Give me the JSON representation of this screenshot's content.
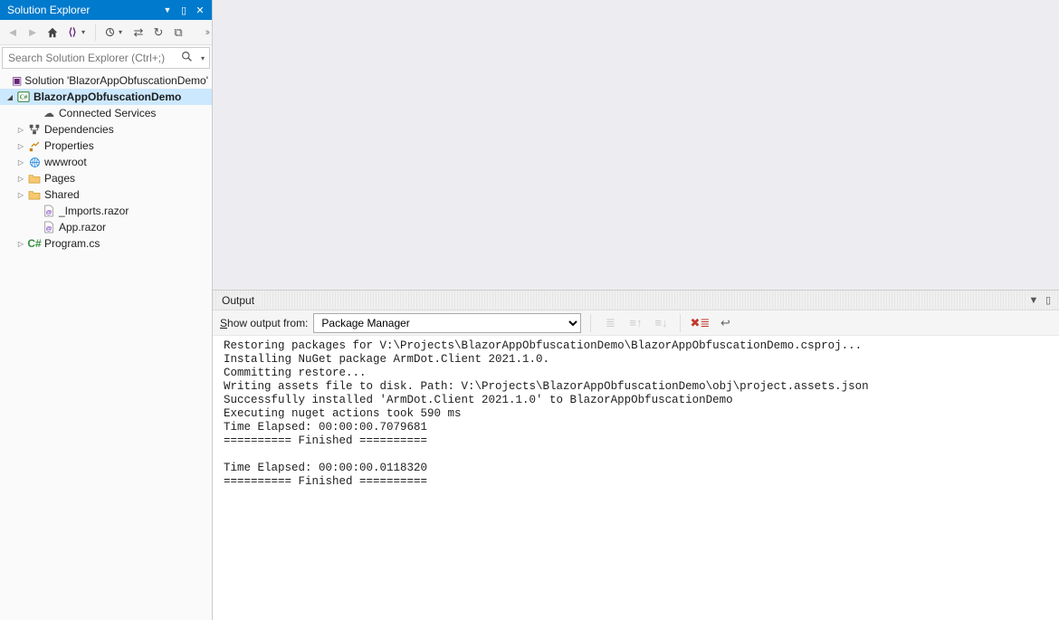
{
  "solutionExplorer": {
    "title": "Solution Explorer",
    "searchPlaceholder": "Search Solution Explorer (Ctrl+;)",
    "tree": {
      "solution": "Solution 'BlazorAppObfuscationDemo'",
      "project": "BlazorAppObfuscationDemo",
      "items": {
        "connectedServices": "Connected Services",
        "dependencies": "Dependencies",
        "properties": "Properties",
        "wwwroot": "wwwroot",
        "pages": "Pages",
        "shared": "Shared",
        "imports": "_Imports.razor",
        "appRazor": "App.razor",
        "programCs": "Program.cs"
      }
    }
  },
  "output": {
    "title": "Output",
    "showOutputFromLabelPrefix": "S",
    "showOutputFromLabelRest": "how output from:",
    "source": "Package Manager",
    "lines": [
      "Restoring packages for V:\\Projects\\BlazorAppObfuscationDemo\\BlazorAppObfuscationDemo.csproj...",
      "Installing NuGet package ArmDot.Client 2021.1.0.",
      "Committing restore...",
      "Writing assets file to disk. Path: V:\\Projects\\BlazorAppObfuscationDemo\\obj\\project.assets.json",
      "Successfully installed 'ArmDot.Client 2021.1.0' to BlazorAppObfuscationDemo",
      "Executing nuget actions took 590 ms",
      "Time Elapsed: 00:00:00.7079681",
      "========== Finished ==========",
      "",
      "Time Elapsed: 00:00:00.0118320",
      "========== Finished =========="
    ]
  }
}
